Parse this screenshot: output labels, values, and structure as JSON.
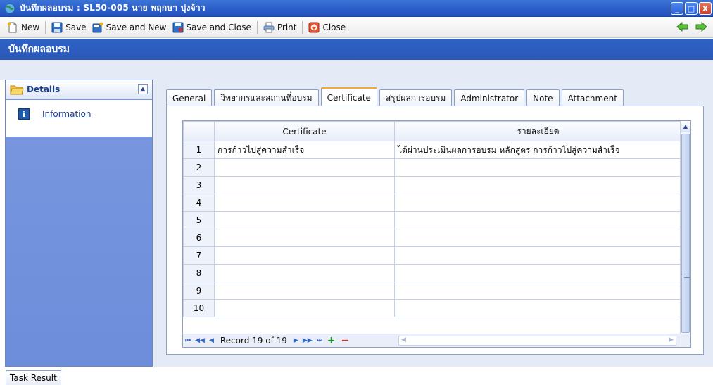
{
  "window": {
    "title": "บันทึกผลอบรม : SL50-005 นาย พฤกษา บุ่งจ้าว",
    "minimize": "_",
    "maximize": "□",
    "close": "X"
  },
  "toolbar": {
    "new_label": "New",
    "save_label": "Save",
    "save_new_label": "Save and New",
    "save_close_label": "Save and Close",
    "print_label": "Print",
    "close_label": "Close"
  },
  "header": {
    "title": "บันทึกผลอบรม"
  },
  "sidebar": {
    "section_title": "Details",
    "items": [
      {
        "label": "Information",
        "icon": "info-icon"
      }
    ]
  },
  "tabs": [
    {
      "label": "General"
    },
    {
      "label": "วิทยากรและสถานที่อบรม"
    },
    {
      "label": "Certificate",
      "active": true
    },
    {
      "label": "สรุปผลการอบรม"
    },
    {
      "label": "Administrator"
    },
    {
      "label": "Note"
    },
    {
      "label": "Attachment"
    }
  ],
  "grid": {
    "columns": [
      "Certificate",
      "รายละเอียด"
    ],
    "rows": [
      {
        "num": "1",
        "certificate": "การก้าวไปสู่ความสำเร็จ",
        "detail": "ได้ผ่านประเมินผลการอบรม หลักสูตร การก้าวไปสู่ความสำเร็จ"
      },
      {
        "num": "2",
        "certificate": "",
        "detail": ""
      },
      {
        "num": "3",
        "certificate": "",
        "detail": ""
      },
      {
        "num": "4",
        "certificate": "",
        "detail": ""
      },
      {
        "num": "5",
        "certificate": "",
        "detail": ""
      },
      {
        "num": "6",
        "certificate": "",
        "detail": ""
      },
      {
        "num": "7",
        "certificate": "",
        "detail": ""
      },
      {
        "num": "8",
        "certificate": "",
        "detail": ""
      },
      {
        "num": "9",
        "certificate": "",
        "detail": ""
      },
      {
        "num": "10",
        "certificate": "",
        "detail": ""
      }
    ],
    "navigator": {
      "record_text": "Record 19 of 19"
    }
  },
  "footer": {
    "task_result_label": "Task Result"
  },
  "colors": {
    "title_bar": "#2a5cc7",
    "header_band": "#2f62c6",
    "sidebar": "#7a98e0",
    "active_tab_accent": "#f3a83a"
  }
}
